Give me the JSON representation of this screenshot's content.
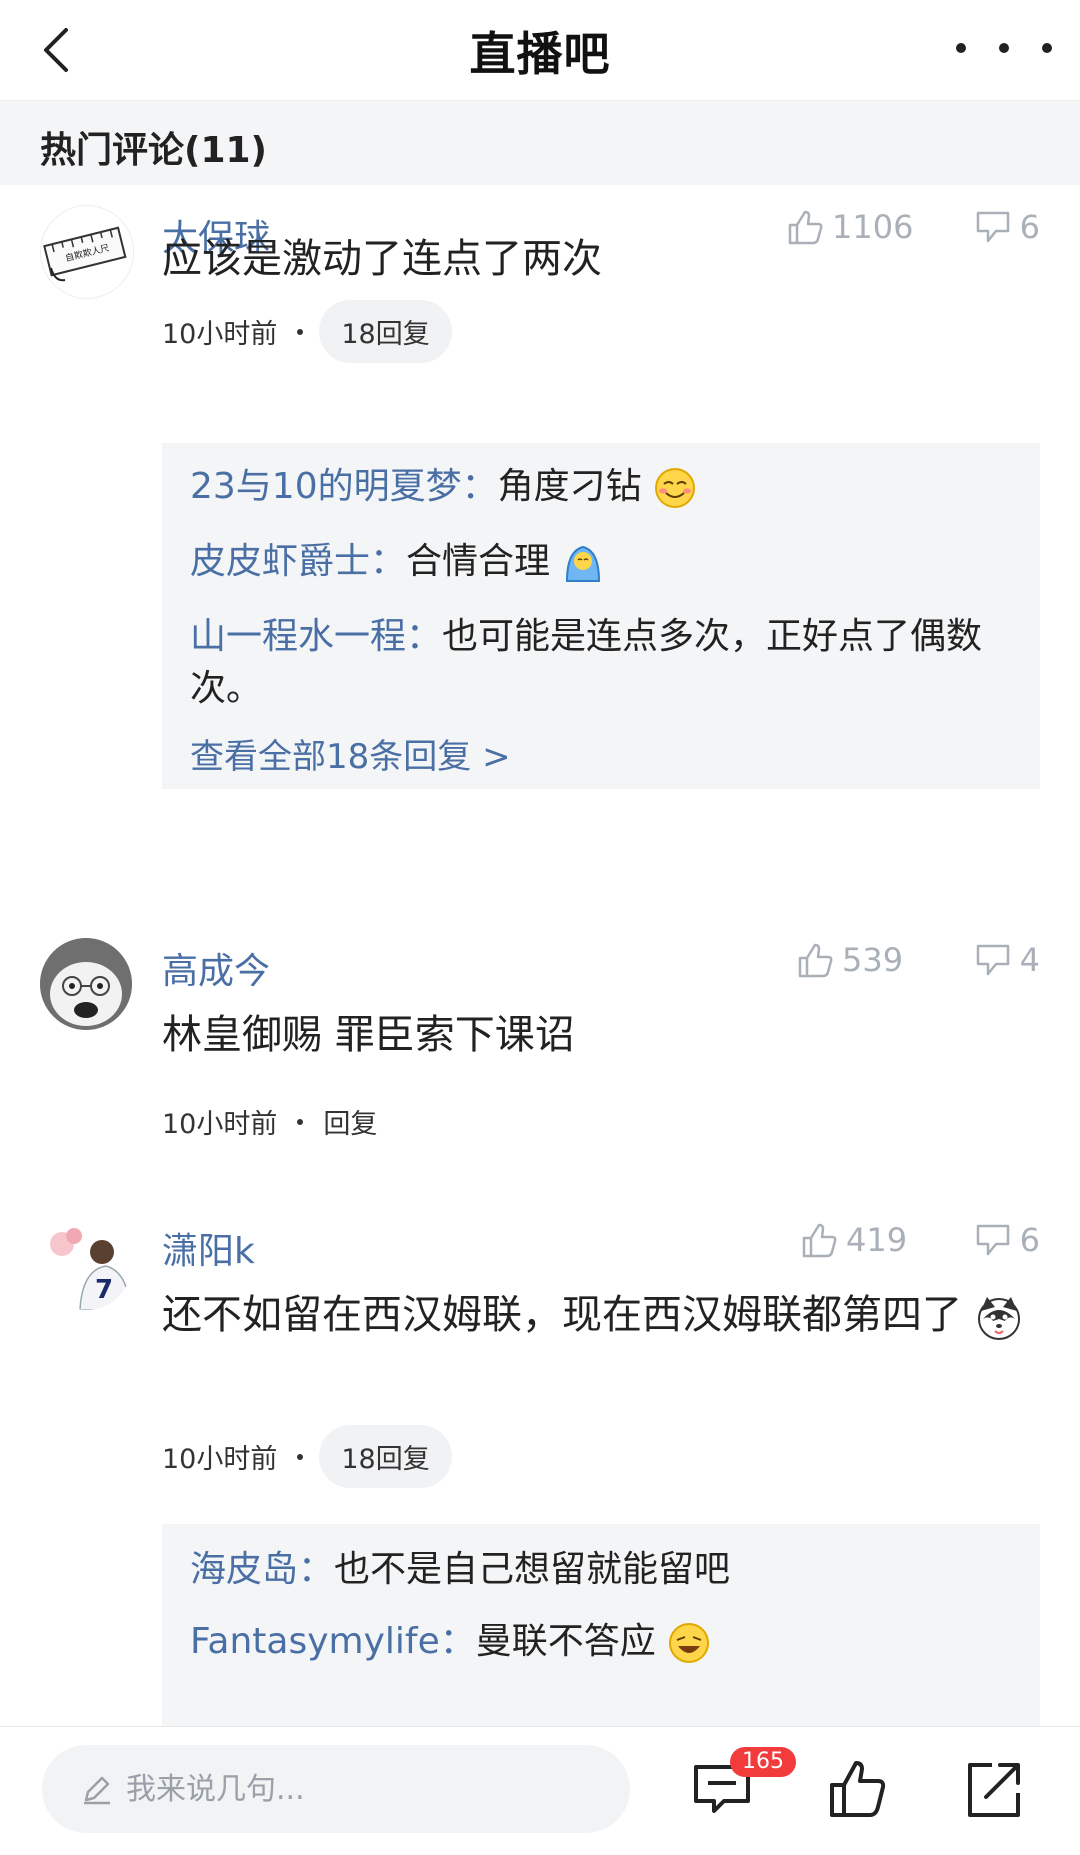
{
  "nav": {
    "title": "直播吧"
  },
  "section": {
    "title": "热门评论(11)"
  },
  "comments": [
    {
      "user": "太保球",
      "likes": "1106",
      "dislikes": "6",
      "text": "应该是激动了连点了两次",
      "time": "10小时前",
      "reply_label": "18回复",
      "avatar_text": "自欺欺人尺",
      "replies": [
        {
          "name": "23与10的明夏梦：",
          "text": "角度刁钻"
        },
        {
          "name": "皮皮虾爵士：",
          "text": "合情合理"
        },
        {
          "name": "山一程水一程：",
          "text": "也可能是连点多次，正好点了偶数次。"
        }
      ],
      "view_all": "查看全部18条回复 >"
    },
    {
      "user": "高成今",
      "likes": "539",
      "dislikes": "4",
      "text": "林皇御赐 罪臣索下课诏",
      "time": "10小时前",
      "reply_label": "回复"
    },
    {
      "user": "潇阳k",
      "likes": "419",
      "dislikes": "6",
      "text": "还不如留在西汉姆联，现在西汉姆联都第四了",
      "time": "10小时前",
      "reply_label": "18回复",
      "jersey_number": "7",
      "replies": [
        {
          "name": "海皮岛：",
          "text": "也不是自己想留就能留吧"
        },
        {
          "name": "Fantasymylife：",
          "text": "曼联不答应"
        }
      ]
    }
  ],
  "bottom": {
    "input_placeholder": "我来说几句...",
    "comment_count": "165"
  },
  "colors": {
    "username": "#4a6fa5",
    "badge": "#f23c3c",
    "panel": "#f4f5f7"
  },
  "icons": [
    "back-icon",
    "more-icon",
    "thumbs-up-icon",
    "thumbs-down-icon",
    "pen-icon",
    "comments-icon",
    "like-icon",
    "share-icon"
  ]
}
